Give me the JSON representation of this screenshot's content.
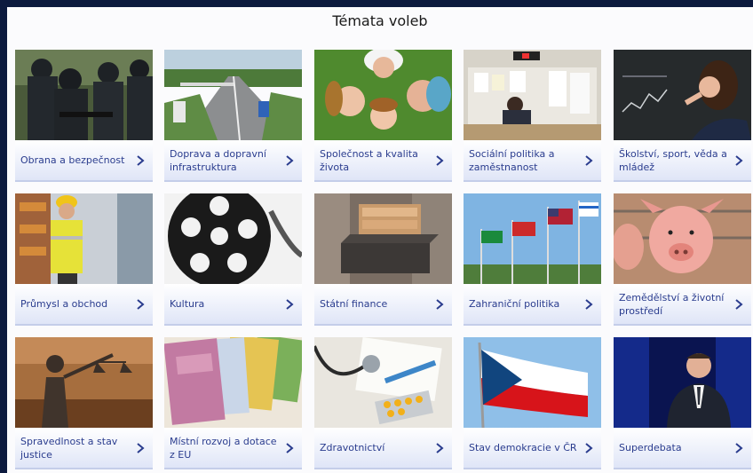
{
  "page": {
    "title": "Témata voleb"
  },
  "topics": [
    {
      "label": "Obrana a bezpečnost",
      "icon": "soldiers-photo"
    },
    {
      "label": "Doprava a dopravní infrastruktura",
      "icon": "highway-photo"
    },
    {
      "label": "Společnost a kvalita života",
      "icon": "family-photo"
    },
    {
      "label": "Sociální politika a zaměstnanost",
      "icon": "job-board-photo"
    },
    {
      "label": "Školství, sport, věda a mládež",
      "icon": "blackboard-photo"
    },
    {
      "label": "Průmysl a obchod",
      "icon": "warehouse-worker-photo"
    },
    {
      "label": "Kultura",
      "icon": "film-reel-photo"
    },
    {
      "label": "Státní finance",
      "icon": "money-box-photo"
    },
    {
      "label": "Zahraniční politika",
      "icon": "flags-photo"
    },
    {
      "label": "Zemědělství a životní prostředí",
      "icon": "pig-photo"
    },
    {
      "label": "Spravedlnost a stav justice",
      "icon": "justitia-photo"
    },
    {
      "label": "Místní rozvoj a dotace z EU",
      "icon": "euro-banknotes-photo"
    },
    {
      "label": "Zdravotnictví",
      "icon": "stethoscope-pills-photo"
    },
    {
      "label": "Stav demokracie v ČR",
      "icon": "czech-flag-photo"
    },
    {
      "label": "Superdebata",
      "icon": "tv-host-photo"
    }
  ],
  "colors": {
    "link": "#2a3c8e",
    "frame": "#0c1a3e"
  }
}
